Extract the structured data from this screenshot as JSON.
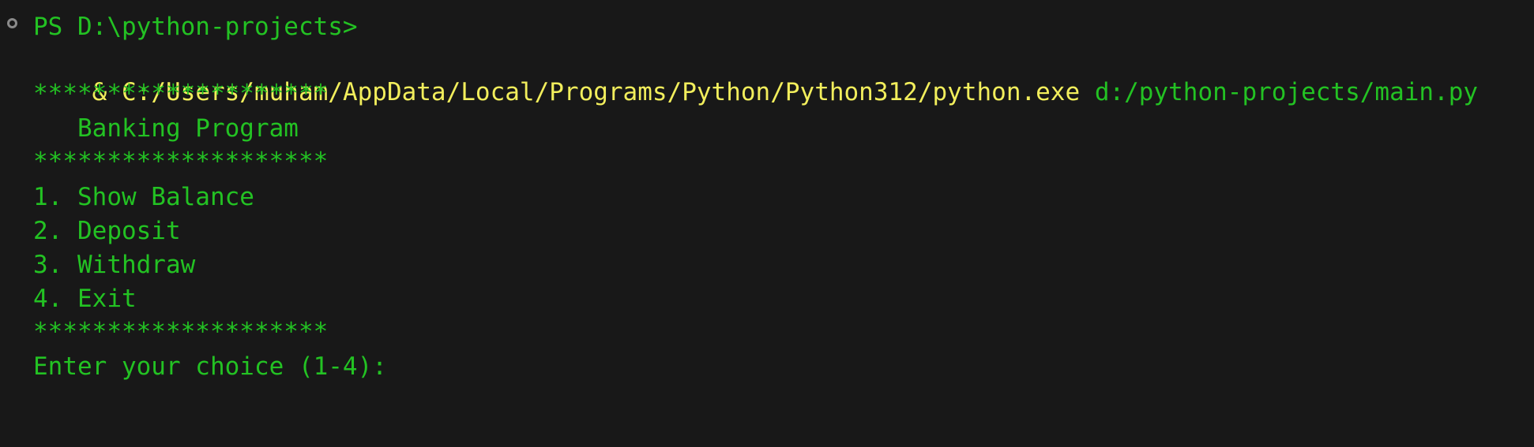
{
  "terminal": {
    "prompt": "PS D:\\python-projects>",
    "command": {
      "ampersand": "&",
      "executable": "C:/Users/muham/AppData/Local/Programs/Python/Python312/python.exe",
      "script": "d:/python-projects/main.py"
    },
    "output": {
      "separator_top": "********************",
      "title": "   Banking Program",
      "separator_mid": "********************",
      "menu": [
        "1. Show Balance",
        "2. Deposit",
        "3. Withdraw",
        "4. Exit"
      ],
      "separator_bottom": "********************",
      "input_prompt": "Enter your choice (1-4):"
    },
    "colors": {
      "background": "#181818",
      "output_text": "#23c223",
      "command_text": "#f2ee5c",
      "marker": "#8a8a8a"
    }
  }
}
